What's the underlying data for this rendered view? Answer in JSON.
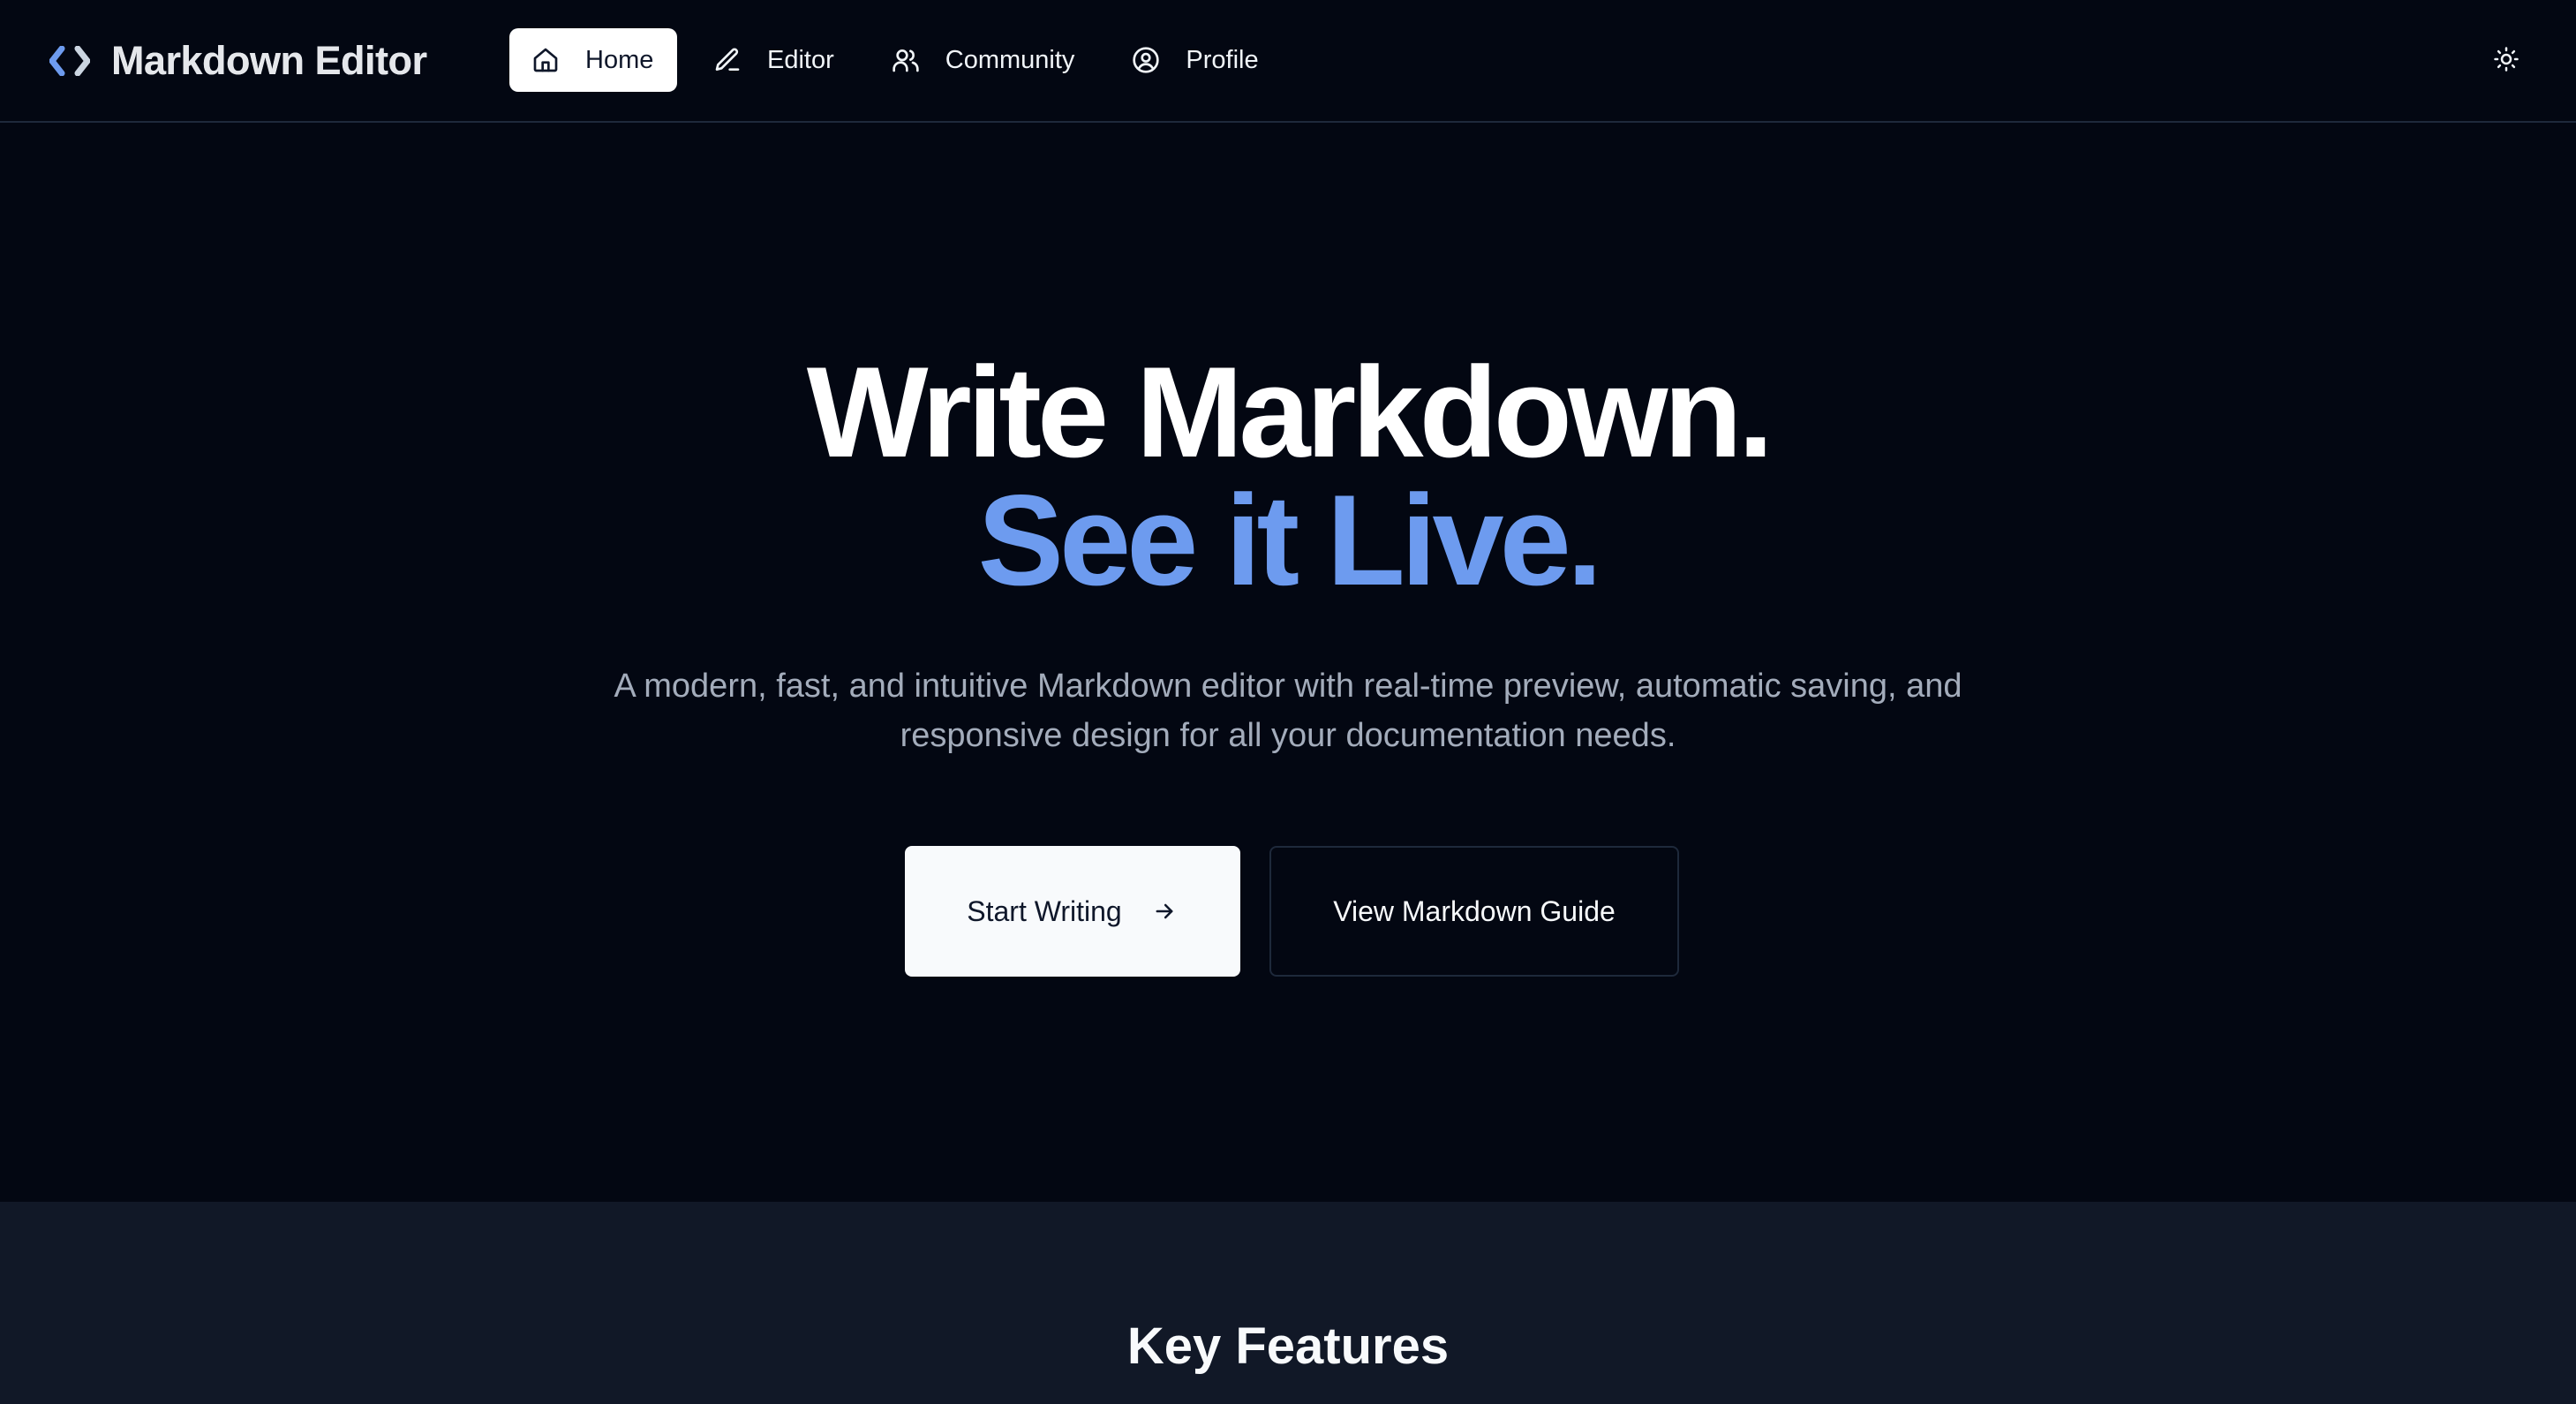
{
  "app": {
    "brand": "Markdown Editor"
  },
  "nav": {
    "items": [
      {
        "label": "Home",
        "icon": "home-icon",
        "active": true
      },
      {
        "label": "Editor",
        "icon": "pencil-icon",
        "active": false
      },
      {
        "label": "Community",
        "icon": "users-icon",
        "active": false
      },
      {
        "label": "Profile",
        "icon": "user-circle-icon",
        "active": false
      }
    ],
    "theme_toggle_icon": "sun-icon"
  },
  "hero": {
    "title_line1": "Write Markdown.",
    "title_line2": "See it Live.",
    "description": "A modern, fast, and intuitive Markdown editor with real-time preview, automatic saving, and responsive design for all your documentation needs.",
    "primary_button": "Start Writing",
    "primary_button_icon": "arrow-right-icon",
    "secondary_button": "View Markdown Guide"
  },
  "features": {
    "title": "Key Features"
  },
  "colors": {
    "background": "#030712",
    "accent": "#6d9bef",
    "section_background": "#111827",
    "muted_text": "#a3acbb"
  }
}
